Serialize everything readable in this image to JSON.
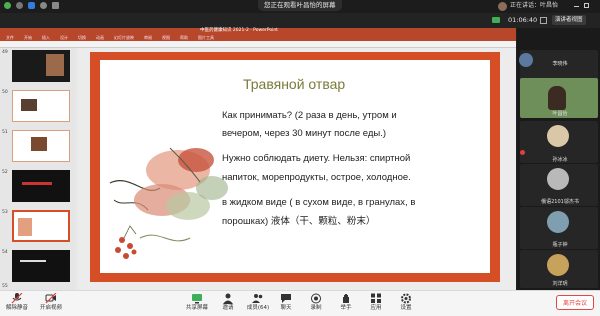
{
  "top_bar": {
    "viewing_label": "您正在观看叶昌怡的屏幕",
    "speaking_label": "正在讲话：叶昌怡"
  },
  "second_bar": {
    "timer": "01:06:40",
    "presenter_view_label": "演讲者视图"
  },
  "ppt": {
    "title": "中医药健康知识 2021-2 · PowerPoint",
    "menu": [
      "文件",
      "开始",
      "插入",
      "设计",
      "切换",
      "动画",
      "幻灯片放映",
      "审阅",
      "视图",
      "帮助",
      "图片工具"
    ],
    "slide_numbers": [
      "49",
      "50",
      "51",
      "52",
      "53",
      "54",
      "55"
    ]
  },
  "slide": {
    "title": "Травяной отвар",
    "line1": "Как принимать? (2 раза в день, утром и",
    "line2": "вечером, через 30 минут после еды.)",
    "line3": "Нужно соблюдать диету. Нельзя: спиртной",
    "line4": "напиток, морепродукты, острое, холодное.",
    "line5": "в жидком виде ( в сухом виде,  в гранулах, в",
    "line6": "порошках) 液体（干、颗粒、粉末）"
  },
  "participants": [
    {
      "name": "李晓伟"
    },
    {
      "name": "叶昌怡"
    },
    {
      "name": "孙冰冰"
    },
    {
      "name": "俄语2101邬杰书"
    },
    {
      "name": "瓶子钟"
    },
    {
      "name": "刘洋玥"
    }
  ],
  "toolbar": {
    "mute_label": "解除静音",
    "video_label": "开启视频",
    "share_label": "共享屏幕",
    "invite_label": "邀请",
    "members_label": "成员(64)",
    "chat_label": "聊天",
    "record_label": "录制",
    "raise_hand_label": "举手",
    "apps_label": "应用",
    "settings_label": "设置",
    "leave_label": "离开会议"
  },
  "colors": {
    "accent": "#d54e26",
    "ppt_brand": "#b7472a",
    "danger": "#e64545"
  }
}
